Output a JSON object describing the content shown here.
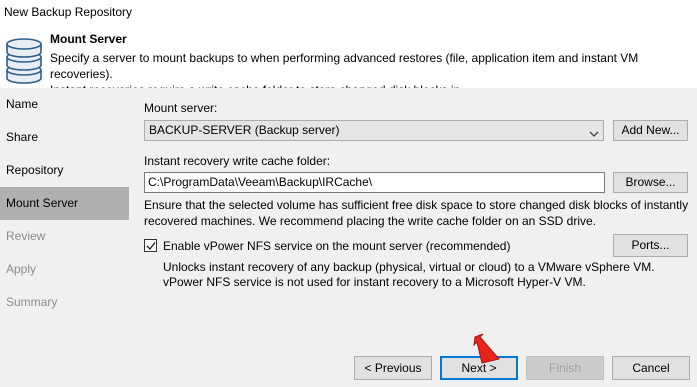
{
  "window": {
    "title": "New Backup Repository"
  },
  "header": {
    "title": "Mount Server",
    "description_line1": "Specify a server to mount backups to when performing advanced restores (file, application item and instant VM recoveries).",
    "description_line2": "Instant recoveries require a write cache folder to store changed disk blocks in.",
    "icon": "database-icon"
  },
  "sidebar": {
    "steps": [
      {
        "label": "Name",
        "state": "done"
      },
      {
        "label": "Share",
        "state": "done"
      },
      {
        "label": "Repository",
        "state": "done"
      },
      {
        "label": "Mount Server",
        "state": "active"
      },
      {
        "label": "Review",
        "state": "disabled"
      },
      {
        "label": "Apply",
        "state": "disabled"
      },
      {
        "label": "Summary",
        "state": "disabled"
      }
    ]
  },
  "main": {
    "mount_server_label": "Mount server:",
    "mount_server_value": "BACKUP-SERVER (Backup server)",
    "add_new_label": "Add New...",
    "cache_folder_label": "Instant recovery write cache folder:",
    "cache_folder_value": "C:\\ProgramData\\Veeam\\Backup\\IRCache\\",
    "browse_label": "Browse...",
    "cache_note_line1": "Ensure that the selected volume has sufficient free disk space to store changed disk blocks of instantly",
    "cache_note_line2": "recovered machines. We recommend placing the write cache folder on an SSD drive.",
    "nfs_checkbox_label": "Enable vPower NFS service on the mount server (recommended)",
    "nfs_checked": true,
    "ports_label": "Ports...",
    "nfs_note_line1": "Unlocks instant recovery of any backup (physical, virtual or cloud) to a VMware vSphere VM.",
    "nfs_note_line2": "vPower NFS service is not used for instant recovery to a Microsoft Hyper-V VM."
  },
  "footer": {
    "previous_label": "< Previous",
    "next_label": "Next >",
    "finish_label": "Finish",
    "cancel_label": "Cancel"
  },
  "colors": {
    "accent": "#0078d7",
    "active_step": "#b0b0b0",
    "cursor": "#e8231a"
  }
}
